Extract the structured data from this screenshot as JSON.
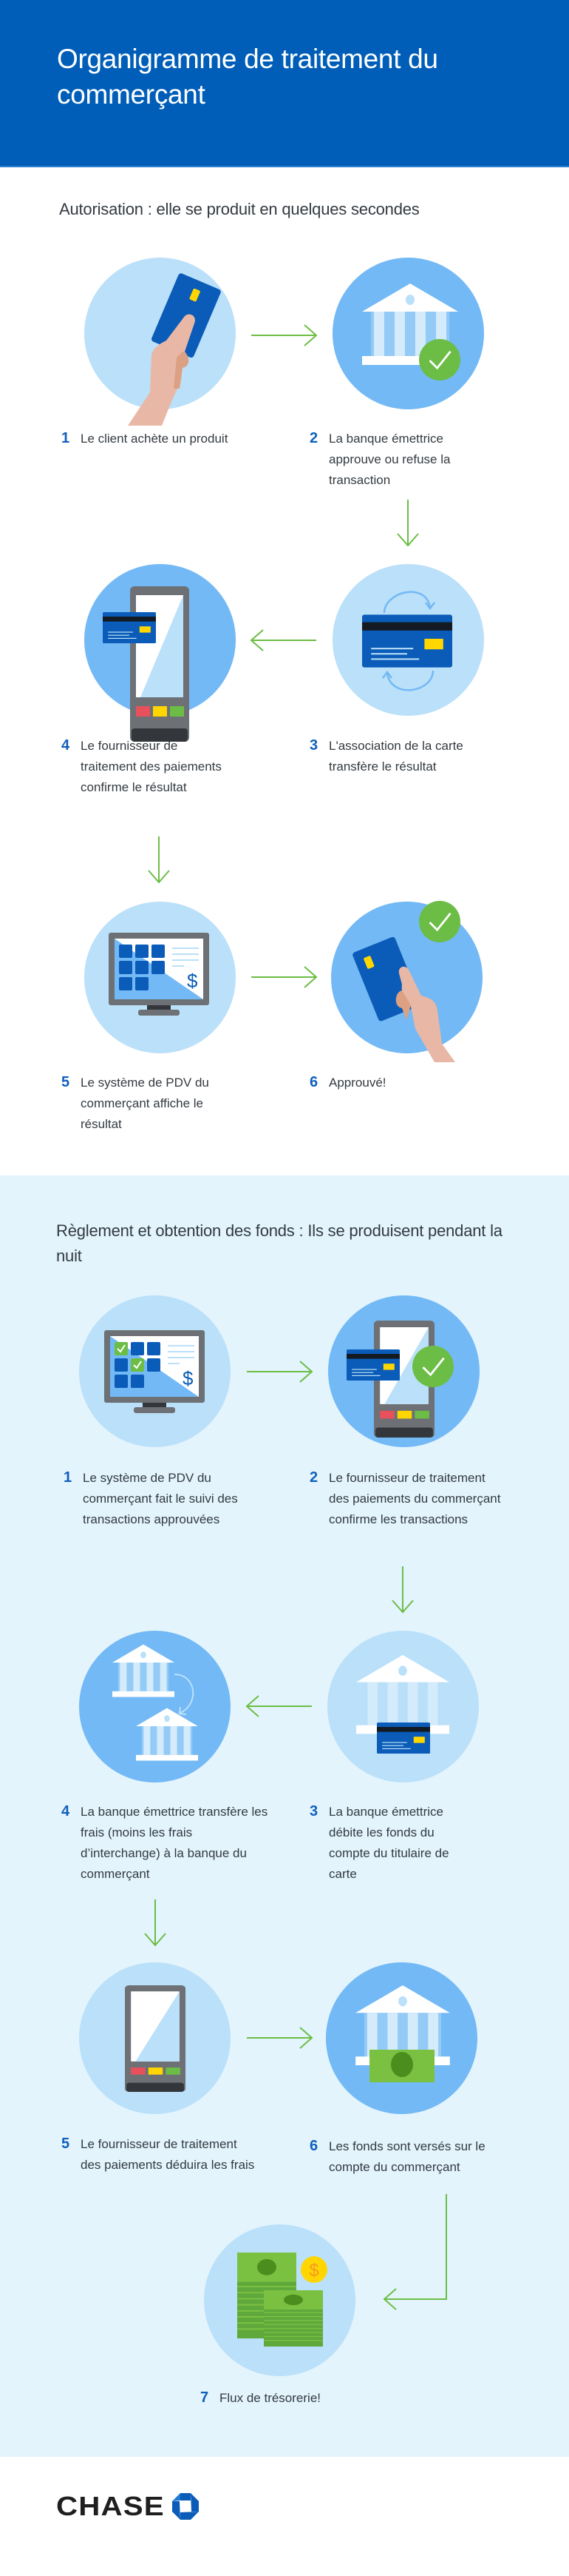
{
  "header": {
    "title": "Organigramme de traitement du commerçant"
  },
  "sections": [
    {
      "heading": "Autorisation : elle se produit en quelques secondes",
      "steps": [
        {
          "number": "1",
          "text": "Le client achète un produit",
          "icon": "hand-holding-card-icon"
        },
        {
          "number": "2",
          "text": "La banque émettrice approuve ou refuse la transaction",
          "icon": "bank-approved-icon"
        },
        {
          "number": "3",
          "text": "L'association de la carte transfère le résultat",
          "icon": "card-sync-icon"
        },
        {
          "number": "4",
          "text": "Le fournisseur de traitement des paiements confirme le résultat",
          "icon": "payment-terminal-card-icon"
        },
        {
          "number": "5",
          "text": "Le système de PDV du commerçant affiche le résultat",
          "icon": "pos-monitor-icon"
        },
        {
          "number": "6",
          "text": "Approuvé!",
          "icon": "card-approved-icon"
        }
      ]
    },
    {
      "heading": "Règlement et obtention des fonds : Ils se produisent pendant la nuit",
      "steps": [
        {
          "number": "1",
          "text": "Le système de PDV du commerçant fait le suivi des transactions approuvées",
          "icon": "pos-monitor-checks-icon"
        },
        {
          "number": "2",
          "text": "Le fournisseur de traitement des paiements du commerçant confirme les transactions",
          "icon": "terminal-card-approved-icon"
        },
        {
          "number": "3",
          "text": "La banque émettrice débite les fonds du compte du titulaire de carte",
          "icon": "bank-card-icon"
        },
        {
          "number": "4",
          "text": "La banque émettrice transfère les frais (moins les frais d’interchange) à la banque du commerçant",
          "icon": "bank-transfer-icon"
        },
        {
          "number": "5",
          "text": "Le fournisseur de traitement des paiements déduira les frais",
          "icon": "payment-terminal-icon"
        },
        {
          "number": "6",
          "text": "Les fonds sont versés sur le compte du commerçant",
          "icon": "bank-money-icon"
        },
        {
          "number": "7",
          "text": "Flux de trésorerie!",
          "icon": "cash-stack-icon"
        }
      ]
    }
  ],
  "footer": {
    "brand": "CHASE"
  },
  "colors": {
    "header_blue": "#005eb8",
    "number_blue": "#0f5fbd",
    "arrow_green": "#6cbd45",
    "circle_light": "#bbe0f9",
    "circle_mid": "#73b9f5",
    "section2_bg": "#e3f4fd"
  }
}
